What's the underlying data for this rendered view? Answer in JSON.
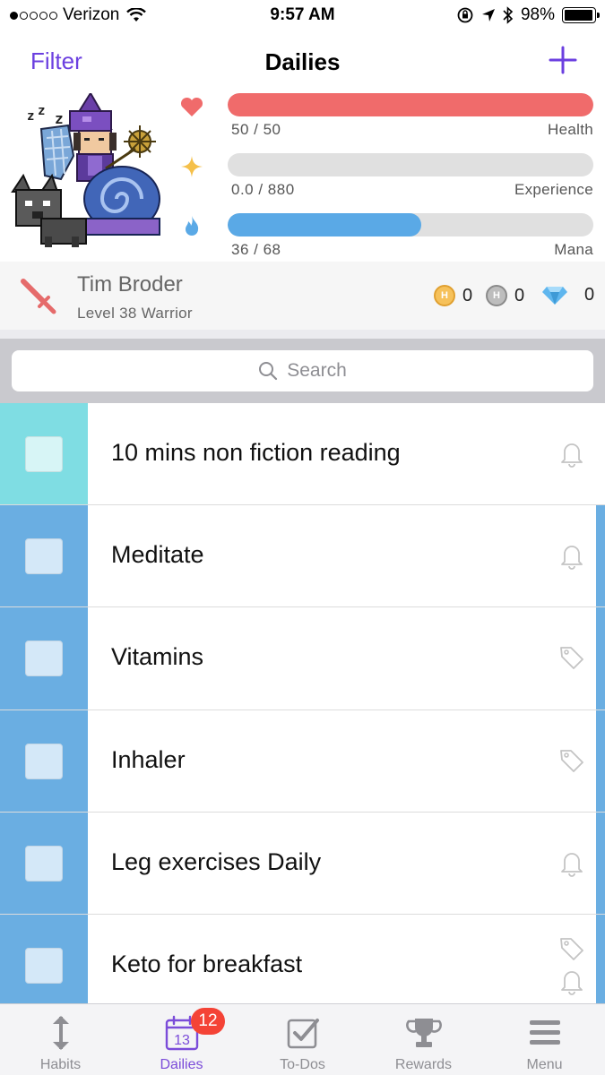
{
  "status_bar": {
    "carrier": "Verizon",
    "signal_dots_filled": 1,
    "signal_dots_total": 5,
    "time": "9:57 AM",
    "battery_text": "98%",
    "battery_level": 0.98
  },
  "nav": {
    "filter_label": "Filter",
    "title": "Dailies",
    "add_icon": "plus-icon"
  },
  "stats": {
    "health": {
      "value_text": "50 / 50",
      "label": "Health",
      "fraction": 1.0,
      "color": "#f06b6b",
      "icon": "heart-icon"
    },
    "experience": {
      "value_text": "0.0 / 880",
      "label": "Experience",
      "fraction": 0.0,
      "color": "#f5c04a",
      "icon": "star-icon"
    },
    "mana": {
      "value_text": "36 / 68",
      "label": "Mana",
      "fraction": 0.53,
      "color": "#5aa9e6",
      "icon": "flame-icon"
    }
  },
  "profile": {
    "name": "Tim Broder",
    "level_text": "Level 38 Warrior",
    "class_icon": "sword-icon",
    "gold": "0",
    "silver": "0",
    "gems": "0"
  },
  "search": {
    "placeholder": "Search"
  },
  "tasks": [
    {
      "title": "10 mins non fiction reading",
      "color": "#7fdde3",
      "check_color": "#d7f5f6",
      "icon": "bell-icon"
    },
    {
      "title": "Meditate",
      "color": "#6aaee2",
      "check_color": "#d4e8f8",
      "icon": "bell-icon"
    },
    {
      "title": "Vitamins",
      "color": "#6aaee2",
      "check_color": "#d4e8f8",
      "icon": "tag-icon"
    },
    {
      "title": "Inhaler",
      "color": "#6aaee2",
      "check_color": "#d4e8f8",
      "icon": "tag-icon"
    },
    {
      "title": "Leg exercises Daily",
      "color": "#6aaee2",
      "check_color": "#d4e8f8",
      "icon": "bell-icon"
    },
    {
      "title": "Keto for breakfast",
      "color": "#6aaee2",
      "check_color": "#d4e8f8",
      "icon": "tag-and-bell-icon"
    }
  ],
  "tabs": [
    {
      "label": "Habits",
      "icon": "arrows-vertical-icon",
      "active": false
    },
    {
      "label": "Dailies",
      "icon": "calendar-icon",
      "active": true,
      "badge": "12",
      "calendar_day": "13"
    },
    {
      "label": "To-Dos",
      "icon": "checkbox-icon",
      "active": false
    },
    {
      "label": "Rewards",
      "icon": "trophy-icon",
      "active": false
    },
    {
      "label": "Menu",
      "icon": "hamburger-icon",
      "active": false
    }
  ],
  "colors": {
    "accent": "#6b3fe0",
    "health": "#f06b6b",
    "experience": "#f5c04a",
    "mana": "#5aa9e6",
    "daily_light": "#7fdde3",
    "daily_blue": "#6aaee2",
    "badge": "#f44336"
  }
}
